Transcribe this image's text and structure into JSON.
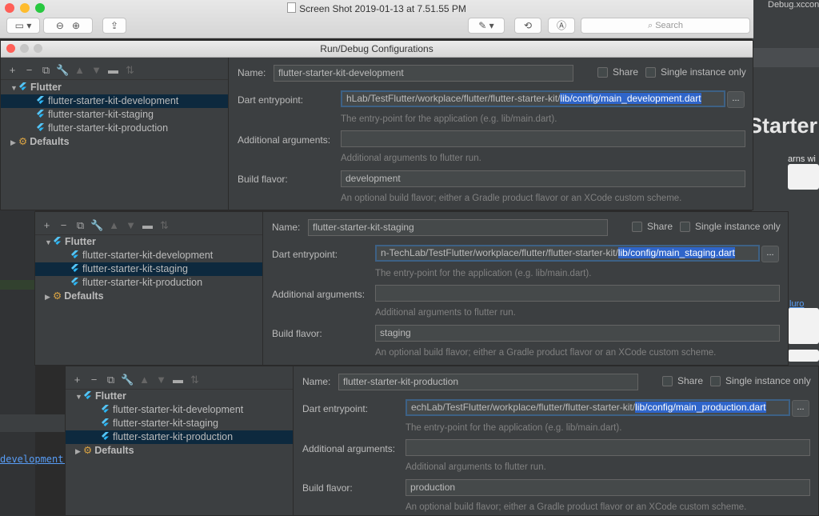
{
  "preview": {
    "title": "Screen Shot 2019-01-13 at 7.51.55 PM",
    "search_placeholder": "Search",
    "zoom_out_icon": "zoom-out-icon",
    "zoom_in_icon": "zoom-in-icon"
  },
  "background": {
    "tab_label": "Debug.xcconf",
    "starter_text": "Starter",
    "arns_text": "arns wi",
    "link_text": "luro",
    "bottom_link": "development.da"
  },
  "dialog_title": "Run/Debug Configurations",
  "common": {
    "name_label": "Name:",
    "share_label": "Share",
    "single_instance_label": "Single instance only",
    "entry_label": "Dart entrypoint:",
    "entry_hint": "The entry-point for the application (e.g. lib/main.dart).",
    "args_label": "Additional arguments:",
    "args_hint": "Additional arguments to flutter run.",
    "flavor_label": "Build flavor:",
    "flavor_hint": "An optional build flavor; either a Gradle product flavor or an XCode custom scheme.",
    "browse_label": "...",
    "flutter_label": "Flutter",
    "defaults_label": "Defaults",
    "config_dev": "flutter-starter-kit-development",
    "config_staging": "flutter-starter-kit-staging",
    "config_prod": "flutter-starter-kit-production"
  },
  "dialogs": [
    {
      "name_value": "flutter-starter-kit-development",
      "entry_prefix": "hLab/TestFlutter/workplace/flutter/flutter-starter-kit/",
      "entry_selected": "lib/config/main_development.dart",
      "flavor_value": "development",
      "selected": "development"
    },
    {
      "name_value": "flutter-starter-kit-staging",
      "entry_prefix": "n-TechLab/TestFlutter/workplace/flutter/flutter-starter-kit/",
      "entry_selected": "lib/config/main_staging.dart",
      "flavor_value": "staging",
      "selected": "staging"
    },
    {
      "name_value": "flutter-starter-kit-production",
      "entry_prefix": "echLab/TestFlutter/workplace/flutter/flutter-starter-kit/",
      "entry_selected": "lib/config/main_production.dart",
      "flavor_value": "production",
      "selected": "production"
    }
  ],
  "colors": {
    "selection": "#0d293e",
    "text_highlight": "#2f65ca",
    "panel_bg": "#3c3f41",
    "flutter_blue": "#40c4ff"
  }
}
